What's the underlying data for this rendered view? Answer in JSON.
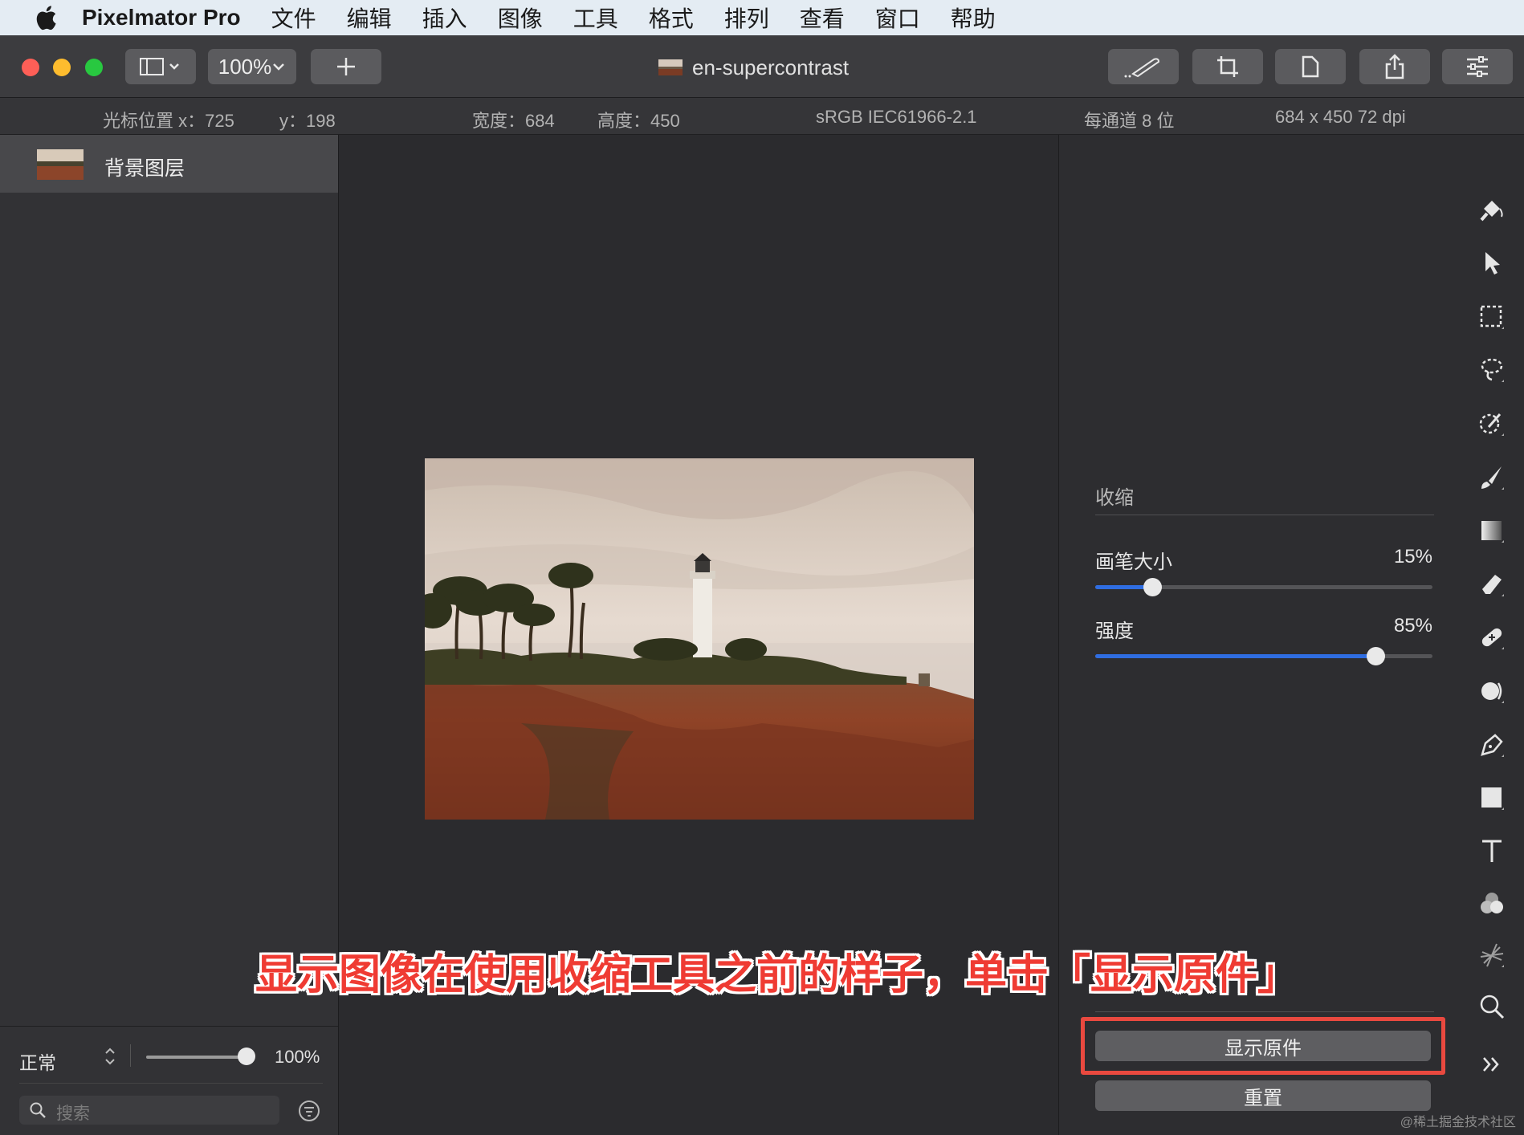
{
  "menubar": {
    "app_name": "Pixelmator Pro",
    "items": [
      "文件",
      "编辑",
      "插入",
      "图像",
      "工具",
      "格式",
      "排列",
      "查看",
      "窗口",
      "帮助"
    ]
  },
  "toolbar": {
    "zoom": "100%",
    "document_title": "en-supercontrast"
  },
  "infobar": {
    "cursor_x": "光标位置 x：725",
    "cursor_y": "y：198",
    "width": "宽度：684",
    "height": "高度：450",
    "color_profile": "sRGB IEC61966-2.1",
    "bit_depth": "每通道 8 位",
    "size_dpi": "684 x 450 72 dpi"
  },
  "layers": {
    "items": [
      {
        "name": "背景图层"
      }
    ],
    "blend_mode": "正常",
    "opacity": "100%",
    "opacity_fraction": 1.0,
    "search_placeholder": "搜索"
  },
  "panel": {
    "section_title": "收缩",
    "sliders": [
      {
        "label": "画笔大小",
        "value": "15%",
        "fraction": 0.17
      },
      {
        "label": "强度",
        "value": "85%",
        "fraction": 0.83
      }
    ],
    "show_original_label": "显示原件",
    "reset_label": "重置"
  },
  "tools": [
    "paint-bucket-icon",
    "arrange-pointer-icon",
    "rect-select-icon",
    "lasso-select-icon",
    "magic-select-icon",
    "brush-icon",
    "gradient-icon",
    "eraser-icon",
    "repair-icon",
    "retouch-icon",
    "pen-icon",
    "shape-icon",
    "type-icon",
    "color-adjust-icon",
    "distort-icon",
    "zoom-icon",
    "more-tools-icon"
  ],
  "annotation": "显示图像在使用收缩工具之前的样子，单击「显示原件」",
  "watermark": "@稀土掘金技术社区",
  "colors": {
    "accent_blue": "#2f6de1",
    "highlight_red": "#e9493f",
    "annotation_red": "#ef3b33"
  }
}
